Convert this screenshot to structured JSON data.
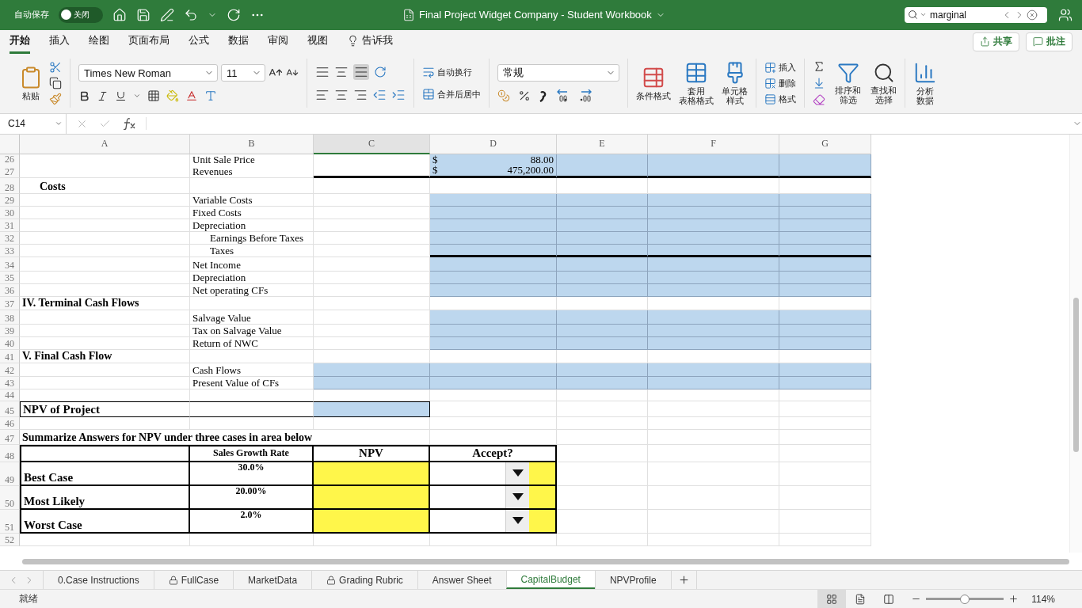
{
  "title_bar": {
    "autosave_label": "自动保存",
    "autosave": {
      "on": false,
      "state_label": "关闭"
    },
    "title": "Final Project Widget Company - Student Workbook",
    "search": {
      "value": "marginal"
    }
  },
  "ribbon_tabs": [
    {
      "label": "开始",
      "selected": true
    },
    {
      "label": "插入",
      "selected": false
    },
    {
      "label": "绘图",
      "selected": false
    },
    {
      "label": "页面布局",
      "selected": false
    },
    {
      "label": "公式",
      "selected": false
    },
    {
      "label": "数据",
      "selected": false
    },
    {
      "label": "审阅",
      "selected": false
    },
    {
      "label": "视图",
      "selected": false
    },
    {
      "label": "告诉我",
      "selected": false,
      "kind": "tell"
    }
  ],
  "share_button": "共享",
  "comments_button": "批注",
  "ribbon": {
    "paste": "粘贴",
    "font_name": "Times New Roman",
    "font_size": "11",
    "wrap_text": "自动换行",
    "merge_center": "合并后居中",
    "number_format": "常规",
    "conditional_format": "条件格式",
    "format_as_table": [
      "套用",
      "表格格式"
    ],
    "cell_styles": [
      "单元格",
      "样式"
    ],
    "insert": "插入",
    "delete": "删除",
    "format": "格式",
    "sort_filter": [
      "排序和",
      "筛选"
    ],
    "find_select": [
      "查找和",
      "选择"
    ],
    "analyze": [
      "分析",
      "数据"
    ]
  },
  "formula_bar": {
    "name_box": "C14"
  },
  "columns": [
    {
      "label": "A",
      "selected": false
    },
    {
      "label": "B",
      "selected": false
    },
    {
      "label": "C",
      "selected": true
    },
    {
      "label": "D",
      "selected": false
    },
    {
      "label": "E",
      "selected": false
    },
    {
      "label": "F",
      "selected": false
    },
    {
      "label": "G",
      "selected": false
    }
  ],
  "rows": [
    {
      "number": "26",
      "kind": "normal",
      "cells": [
        {},
        {
          "text": "Unit Sale Price"
        },
        {},
        {
          "currency": "$",
          "text": "88.00",
          "color": "#bdd7ee"
        },
        {
          "color": "#bdd7ee"
        },
        {
          "color": "#bdd7ee"
        },
        {
          "color": "#bdd7ee"
        }
      ]
    },
    {
      "number": "27",
      "kind": "normal",
      "cells": [
        {},
        {
          "text": "Revenues"
        },
        {},
        {
          "currency": "$",
          "text": "475,200.00",
          "color": "#bdd7ee"
        },
        {
          "color": "#bdd7ee"
        },
        {
          "color": "#bdd7ee"
        },
        {
          "color": "#bdd7ee"
        }
      ]
    },
    {
      "number": "28",
      "kind": "normal",
      "cells": [
        {
          "text": "Costs",
          "bold": true,
          "indent": true
        },
        {},
        {},
        {},
        {},
        {},
        {}
      ]
    },
    {
      "number": "29",
      "kind": "normal",
      "cells": [
        {},
        {
          "text": "Variable Costs"
        },
        {},
        {
          "color": "#bdd7ee"
        },
        {
          "color": "#bdd7ee"
        },
        {
          "color": "#bdd7ee"
        },
        {
          "color": "#bdd7ee"
        }
      ]
    },
    {
      "number": "30",
      "kind": "normal",
      "cells": [
        {},
        {
          "text": "Fixed Costs"
        },
        {},
        {
          "color": "#bdd7ee"
        },
        {
          "color": "#bdd7ee"
        },
        {
          "color": "#bdd7ee"
        },
        {
          "color": "#bdd7ee"
        }
      ]
    },
    {
      "number": "31",
      "kind": "normal",
      "cells": [
        {},
        {
          "text": "Depreciation"
        },
        {},
        {
          "color": "#bdd7ee"
        },
        {
          "color": "#bdd7ee"
        },
        {
          "color": "#bdd7ee"
        },
        {
          "color": "#bdd7ee"
        }
      ]
    },
    {
      "number": "32",
      "kind": "normal",
      "cells": [
        {},
        {
          "text": "Earnings Before Taxes",
          "indent": true
        },
        {},
        {
          "color": "#bdd7ee"
        },
        {
          "color": "#bdd7ee"
        },
        {
          "color": "#bdd7ee"
        },
        {
          "color": "#bdd7ee"
        }
      ]
    },
    {
      "number": "33",
      "kind": "normal",
      "cells": [
        {},
        {
          "text": "Taxes",
          "indent": true
        },
        {},
        {
          "color": "#bdd7ee"
        },
        {
          "color": "#bdd7ee"
        },
        {
          "color": "#bdd7ee"
        },
        {
          "color": "#bdd7ee"
        }
      ]
    },
    {
      "number": "34",
      "kind": "normal",
      "cells": [
        {},
        {
          "text": "Net Income"
        },
        {},
        {
          "color": "#bdd7ee"
        },
        {
          "color": "#bdd7ee"
        },
        {
          "color": "#bdd7ee"
        },
        {
          "color": "#bdd7ee"
        }
      ]
    },
    {
      "number": "35",
      "kind": "normal",
      "cells": [
        {},
        {
          "text": "Depreciation"
        },
        {},
        {
          "color": "#bdd7ee"
        },
        {
          "color": "#bdd7ee"
        },
        {
          "color": "#bdd7ee"
        },
        {
          "color": "#bdd7ee"
        }
      ]
    },
    {
      "number": "36",
      "kind": "normal",
      "cells": [
        {},
        {
          "text": "Net operating CFs"
        },
        {},
        {
          "color": "#bdd7ee"
        },
        {
          "color": "#bdd7ee"
        },
        {
          "color": "#bdd7ee"
        },
        {
          "color": "#bdd7ee"
        }
      ]
    },
    {
      "number": "37",
      "kind": "normal",
      "cells": [
        {
          "text": "IV. Terminal Cash Flows",
          "bold": true
        },
        {},
        {},
        {},
        {},
        {},
        {}
      ]
    },
    {
      "number": "38",
      "kind": "normal",
      "cells": [
        {},
        {
          "text": "Salvage Value"
        },
        {},
        {
          "color": "#bdd7ee"
        },
        {
          "color": "#bdd7ee"
        },
        {
          "color": "#bdd7ee"
        },
        {
          "color": "#bdd7ee"
        }
      ]
    },
    {
      "number": "39",
      "kind": "normal",
      "cells": [
        {},
        {
          "text": "Tax on Salvage Value"
        },
        {},
        {
          "color": "#bdd7ee"
        },
        {
          "color": "#bdd7ee"
        },
        {
          "color": "#bdd7ee"
        },
        {
          "color": "#bdd7ee"
        }
      ]
    },
    {
      "number": "40",
      "kind": "normal",
      "cells": [
        {},
        {
          "text": "Return of NWC"
        },
        {},
        {
          "color": "#bdd7ee"
        },
        {
          "color": "#bdd7ee"
        },
        {
          "color": "#bdd7ee"
        },
        {
          "color": "#bdd7ee"
        }
      ]
    },
    {
      "number": "41",
      "kind": "normal",
      "cells": [
        {
          "text": "V. Final Cash Flow",
          "bold": true
        },
        {},
        {},
        {},
        {},
        {},
        {}
      ]
    },
    {
      "number": "42",
      "kind": "normal",
      "cells": [
        {},
        {
          "text": "Cash Flows"
        },
        {
          "color": "#bdd7ee"
        },
        {
          "color": "#bdd7ee"
        },
        {
          "color": "#bdd7ee"
        },
        {
          "color": "#bdd7ee"
        },
        {
          "color": "#bdd7ee"
        }
      ]
    },
    {
      "number": "43",
      "kind": "normal",
      "cells": [
        {},
        {
          "text": "Present Value of CFs"
        },
        {
          "color": "#bdd7ee"
        },
        {
          "color": "#bdd7ee"
        },
        {
          "color": "#bdd7ee"
        },
        {
          "color": "#bdd7ee"
        },
        {
          "color": "#bdd7ee"
        }
      ]
    },
    {
      "number": "44",
      "kind": "normal",
      "cells": [
        {},
        {},
        {},
        {},
        {},
        {},
        {}
      ]
    },
    {
      "number": "45",
      "kind": "boxed",
      "cells": [
        {
          "text": "NPV of Project",
          "bold": true
        },
        {},
        {
          "color": "#bdd7ee"
        },
        {},
        {},
        {},
        {}
      ]
    },
    {
      "number": "46",
      "kind": "normal",
      "cells": [
        {},
        {},
        {},
        {},
        {},
        {},
        {}
      ]
    },
    {
      "number": "47",
      "kind": "normal",
      "cells": [
        {
          "text": "Summarize Answers for NPV under three cases in area below",
          "bold": true
        },
        {},
        {},
        {},
        {},
        {},
        {}
      ]
    },
    {
      "number": "48",
      "kind": "summary",
      "cells": [
        {},
        {
          "text": "Sales Growth Rate",
          "bold": true
        },
        {
          "text": "NPV",
          "bold": true
        },
        {
          "text": "Accept?",
          "bold": true
        },
        {},
        {},
        {}
      ]
    },
    {
      "number": "49",
      "kind": "summary",
      "cells": [
        {
          "text": "Best Case",
          "bold": true
        },
        {
          "text": "30.0%",
          "bold": true
        },
        {
          "color": "#fff64a"
        },
        {
          "kind": "dropdown",
          "color": "#fff64a"
        },
        {},
        {},
        {}
      ]
    },
    {
      "number": "50",
      "kind": "summary",
      "cells": [
        {
          "text": "Most Likely",
          "bold": true
        },
        {
          "text": "20.00%",
          "bold": true
        },
        {
          "color": "#fff64a"
        },
        {
          "kind": "dropdown",
          "color": "#fff64a"
        },
        {},
        {},
        {}
      ]
    },
    {
      "number": "51",
      "kind": "summary",
      "cells": [
        {
          "text": "Worst Case",
          "bold": true
        },
        {
          "text": "2.0%",
          "bold": true
        },
        {
          "color": "#fff64a"
        },
        {
          "kind": "dropdown",
          "color": "#fff64a"
        },
        {},
        {},
        {}
      ]
    },
    {
      "number": "52",
      "kind": "normal",
      "cells": [
        {},
        {},
        {},
        {},
        {},
        {},
        {}
      ]
    }
  ],
  "sheet_tabs": [
    {
      "label": "0.Case Instructions",
      "selected": false,
      "locked": false
    },
    {
      "label": "FullCase",
      "selected": false,
      "locked": true
    },
    {
      "label": "MarketData",
      "selected": false,
      "locked": false
    },
    {
      "label": "Grading Rubric",
      "selected": false,
      "locked": true
    },
    {
      "label": "Answer Sheet",
      "selected": false,
      "locked": false
    },
    {
      "label": "CapitalBudget",
      "selected": true,
      "locked": false
    },
    {
      "label": "NPVProfile",
      "selected": false,
      "locked": false
    }
  ],
  "status_bar": {
    "status": "就绪",
    "views": [
      {
        "kind": "normal",
        "selected": true
      },
      {
        "kind": "page_layout",
        "selected": false
      },
      {
        "kind": "page_break",
        "selected": false
      }
    ],
    "zoom": {
      "level": 0.5,
      "label": "114%"
    }
  }
}
